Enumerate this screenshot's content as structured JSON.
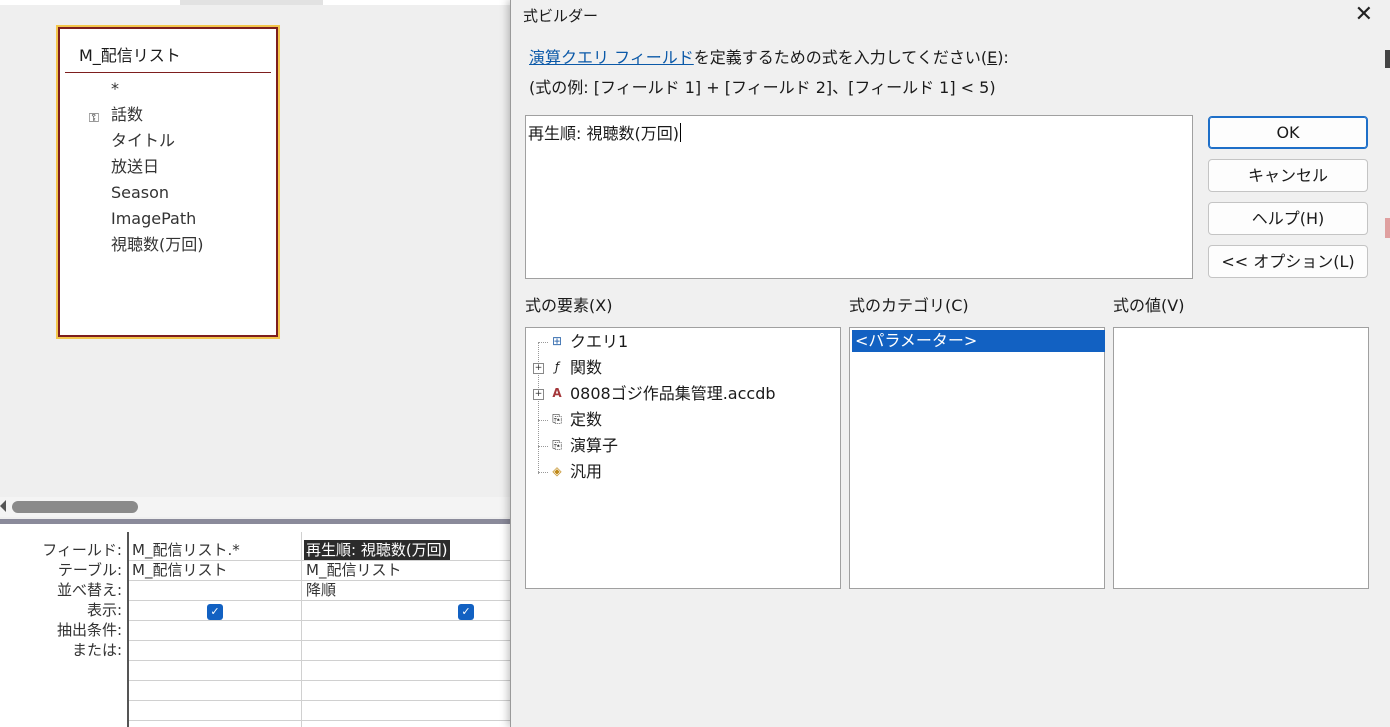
{
  "designer": {
    "table": {
      "title": "M_配信リスト",
      "fields": [
        "*",
        "話数",
        "タイトル",
        "放送日",
        "Season",
        "ImagePath",
        "視聴数(万回)"
      ]
    },
    "grid": {
      "row_labels": [
        "フィールド:",
        "テーブル:",
        "並べ替え:",
        "表示:",
        "抽出条件:",
        "または:"
      ],
      "col1": {
        "field": "M_配信リスト.*",
        "table": "M_配信リスト",
        "sort": "",
        "show": true
      },
      "col2": {
        "field": "再生順: 視聴数(万回)",
        "table": "M_配信リスト",
        "sort": "降順",
        "show": true
      }
    }
  },
  "dialog": {
    "title": "式ビルダー",
    "prompt_link": "演算クエリ フィールド",
    "prompt_mid": "を定義するための式を入力してください(",
    "prompt_key": "E",
    "prompt_end": "):",
    "example": "(式の例: [フィールド 1] + [フィールド 2]、[フィールド 1] < 5)",
    "expression": "再生順: 視聴数(万回)",
    "buttons": {
      "ok": "OK",
      "cancel": "キャンセル",
      "help": "ヘルプ(H)",
      "options": "<< オプション(L)"
    },
    "elements_label": "式の要素(X)",
    "categories_label": "式のカテゴリ(C)",
    "values_label": "式の値(V)",
    "elements": [
      {
        "label": "クエリ1",
        "icon": "query-icon",
        "expandable": false
      },
      {
        "label": "関数",
        "icon": "function-icon",
        "expandable": true
      },
      {
        "label": "0808ゴジ作品集管理.accdb",
        "icon": "access-db-icon",
        "expandable": true
      },
      {
        "label": "定数",
        "icon": "constants-icon",
        "expandable": false
      },
      {
        "label": "演算子",
        "icon": "operators-icon",
        "expandable": false
      },
      {
        "label": "汎用",
        "icon": "common-expressions-icon",
        "expandable": false
      }
    ],
    "categories": [
      "<パラメーター>"
    ]
  }
}
